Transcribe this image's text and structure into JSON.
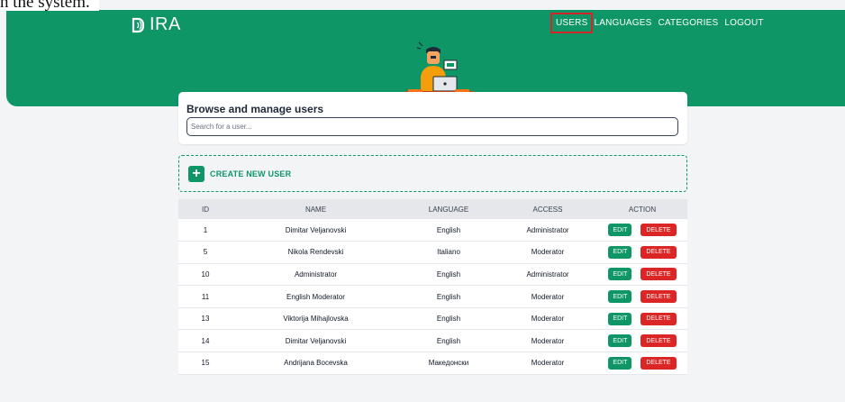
{
  "caption": "n the system.",
  "app": {
    "logo_text": "IRA"
  },
  "nav": {
    "items": [
      {
        "label": "USERS",
        "highlighted": true
      },
      {
        "label": "LANGUAGES",
        "highlighted": false
      },
      {
        "label": "CATEGORIES",
        "highlighted": false
      },
      {
        "label": "LOGOUT",
        "highlighted": false
      }
    ]
  },
  "browse": {
    "title": "Browse and manage users",
    "search_placeholder": "Search for a user..."
  },
  "create": {
    "label": "CREATE NEW USER"
  },
  "table": {
    "headers": [
      "ID",
      "NAME",
      "LANGUAGE",
      "ACCESS",
      "ACTION"
    ],
    "rows": [
      {
        "id": "1",
        "name": "Dimitar Veljanovski",
        "language": "English",
        "access": "Administrator"
      },
      {
        "id": "5",
        "name": "Nikola Rendevski",
        "language": "Italiano",
        "access": "Moderator"
      },
      {
        "id": "10",
        "name": "Administrator",
        "language": "English",
        "access": "Administrator"
      },
      {
        "id": "11",
        "name": "English Moderator",
        "language": "English",
        "access": "Moderator"
      },
      {
        "id": "13",
        "name": "Viktorija Mihajlovska",
        "language": "English",
        "access": "Moderator"
      },
      {
        "id": "14",
        "name": "Dimitar Veljanovski",
        "language": "English",
        "access": "Moderator"
      },
      {
        "id": "15",
        "name": "Andrijana Bocevska",
        "language": "Македонски",
        "access": "Moderator"
      }
    ],
    "edit_label": "EDIT",
    "delete_label": "DELETE"
  },
  "colors": {
    "brand": "#0e9667",
    "danger": "#dc2626",
    "highlight_box": "#d6242b",
    "background": "#f3f4f6"
  },
  "icons": [
    "logo-signal-icon",
    "plus-icon",
    "hero-illustration"
  ]
}
